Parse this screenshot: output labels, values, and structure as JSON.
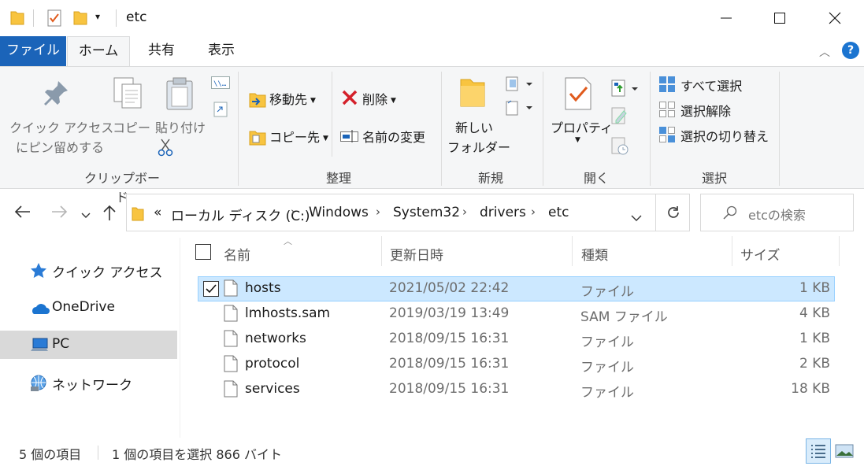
{
  "window": {
    "title": "etc"
  },
  "tabs": [
    {
      "label": "ファイル"
    },
    {
      "label": "ホーム"
    },
    {
      "label": "共有"
    },
    {
      "label": "表示"
    }
  ],
  "ribbon": {
    "clipboard": {
      "pin_line1": "クイック アクセス",
      "pin_line2": "にピン留めする",
      "copy": "コピー",
      "paste": "貼り付け",
      "group": "クリップボード"
    },
    "organize": {
      "move_to": "移動先",
      "copy_to": "コピー先",
      "delete": "削除",
      "rename": "名前の変更",
      "group": "整理"
    },
    "new": {
      "new_folder_line1": "新しい",
      "new_folder_line2": "フォルダー",
      "group": "新規"
    },
    "open": {
      "properties": "プロパティ",
      "group": "開く"
    },
    "select": {
      "select_all": "すべて選択",
      "select_none": "選択解除",
      "invert": "選択の切り替え",
      "group": "選択"
    }
  },
  "address": {
    "overflow": "«",
    "crumbs": [
      "ローカル ディスク (C:)",
      "Windows",
      "System32",
      "drivers",
      "etc"
    ]
  },
  "search": {
    "placeholder": "etcの検索"
  },
  "nav_pane": [
    {
      "label": "クイック アクセス",
      "icon": "star-icon"
    },
    {
      "label": "OneDrive",
      "icon": "cloud-icon"
    },
    {
      "label": "PC",
      "icon": "computer-icon",
      "selected": true
    },
    {
      "label": "ネットワーク",
      "icon": "network-icon"
    }
  ],
  "columns": {
    "name": "名前",
    "modified": "更新日時",
    "type": "種類",
    "size": "サイズ"
  },
  "files": [
    {
      "name": "hosts",
      "modified": "2021/05/02 22:42",
      "type": "ファイル",
      "size": "1 KB",
      "selected": true
    },
    {
      "name": "lmhosts.sam",
      "modified": "2019/03/19 13:49",
      "type": "SAM ファイル",
      "size": "4 KB"
    },
    {
      "name": "networks",
      "modified": "2018/09/15 16:31",
      "type": "ファイル",
      "size": "1 KB"
    },
    {
      "name": "protocol",
      "modified": "2018/09/15 16:31",
      "type": "ファイル",
      "size": "2 KB"
    },
    {
      "name": "services",
      "modified": "2018/09/15 16:31",
      "type": "ファイル",
      "size": "18 KB"
    }
  ],
  "status": {
    "count": "5 個の項目",
    "selection": "1 個の項目を選択  866 バイト"
  },
  "colors": {
    "file_tab": "#1b64b9",
    "selection": "#cce8ff",
    "selection_border": "#99d1ff",
    "folder": "#f8c440",
    "delete_red": "#d4202a"
  }
}
